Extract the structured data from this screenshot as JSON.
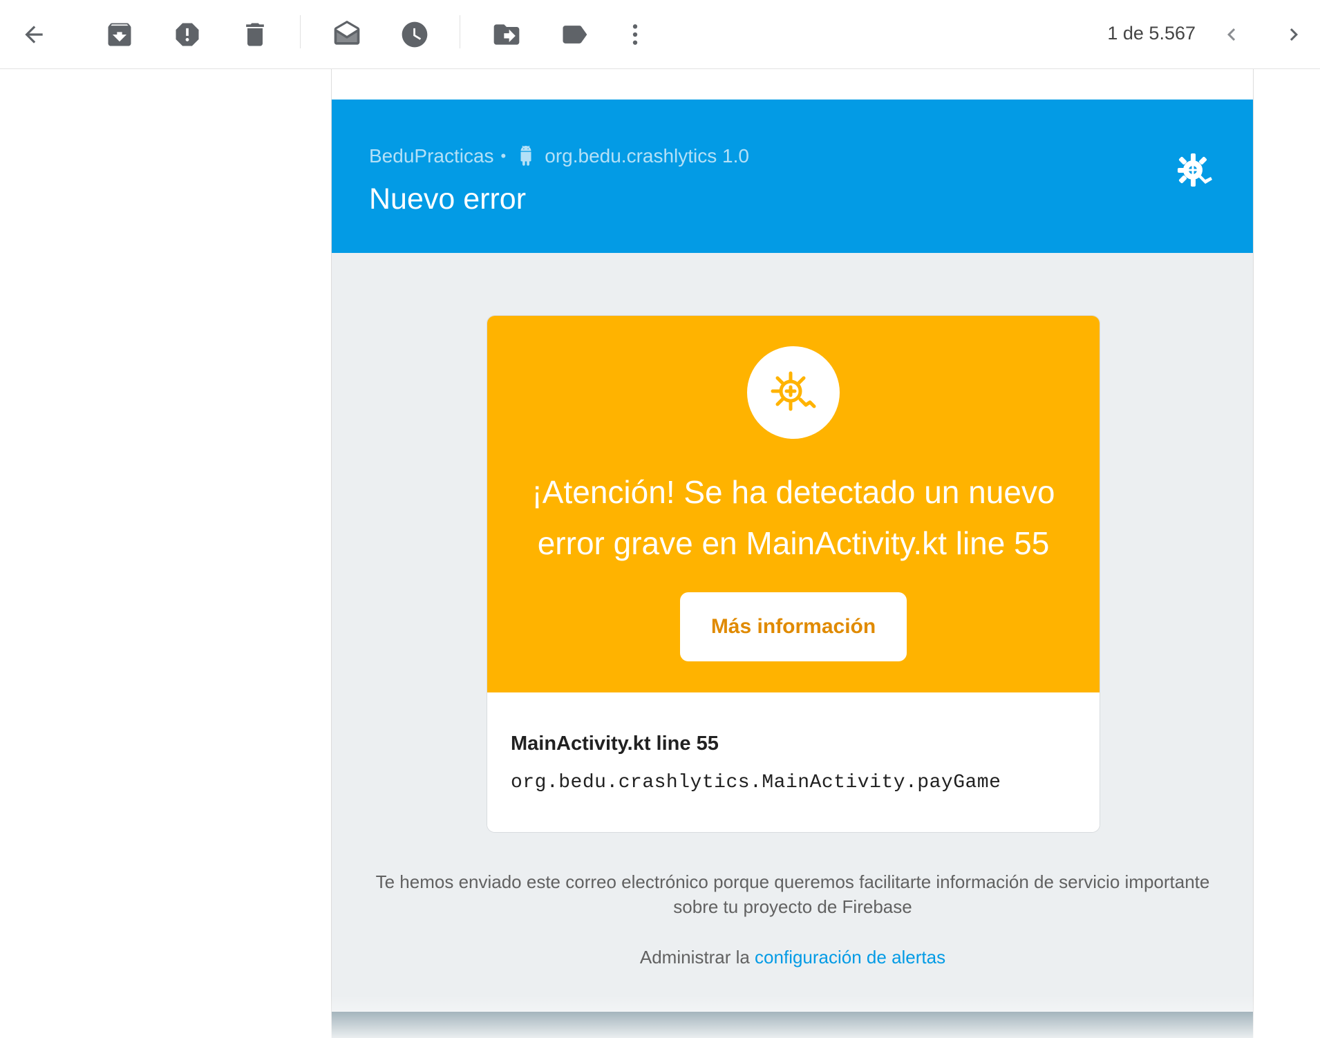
{
  "toolbar": {
    "buttons": [
      {
        "name": "back",
        "icon": "arrow-back-icon"
      },
      {
        "name": "archive",
        "icon": "archive-icon"
      },
      {
        "name": "report-spam",
        "icon": "report-spam-icon"
      },
      {
        "name": "delete",
        "icon": "trash-icon"
      },
      {
        "name": "mark-unread",
        "icon": "mark-unread-icon"
      },
      {
        "name": "snooze",
        "icon": "clock-icon"
      },
      {
        "name": "move-to",
        "icon": "move-to-icon"
      },
      {
        "name": "label",
        "icon": "label-icon"
      },
      {
        "name": "more",
        "icon": "more-vert-icon"
      }
    ],
    "pager_text": "1 de 5.567",
    "prev_icon": "chevron-left-icon",
    "next_icon": "chevron-right-icon"
  },
  "email": {
    "header": {
      "project": "BeduPracticas",
      "separator": "•",
      "platform_icon": "android-icon",
      "app": "org.bedu.crashlytics 1.0",
      "title": "Nuevo error",
      "logo_icon": "crashlytics-logo-icon"
    },
    "card": {
      "icon": "crashlytics-bug-icon",
      "alert_text": "¡Atención! Se ha detectado un nuevo error grave en MainActivity.kt line 55",
      "button_label": "Más información",
      "file_line": "MainActivity.kt line 55",
      "method_line": "org.bedu.crashlytics.MainActivity.payGame"
    },
    "footer_note": "Te hemos enviado este correo electrónico porque queremos facilitarte información de servicio importante sobre tu proyecto de Firebase",
    "manage_prefix": "Administrar la",
    "manage_link": "configuración de alertas"
  },
  "colors": {
    "header_blue": "#039be5",
    "card_amber": "#ffb300",
    "button_text": "#e08a00",
    "link_blue": "#039be5",
    "background_gray": "#eceff1",
    "bottom_band": "#78909c",
    "icon_gray": "#5f6368"
  }
}
